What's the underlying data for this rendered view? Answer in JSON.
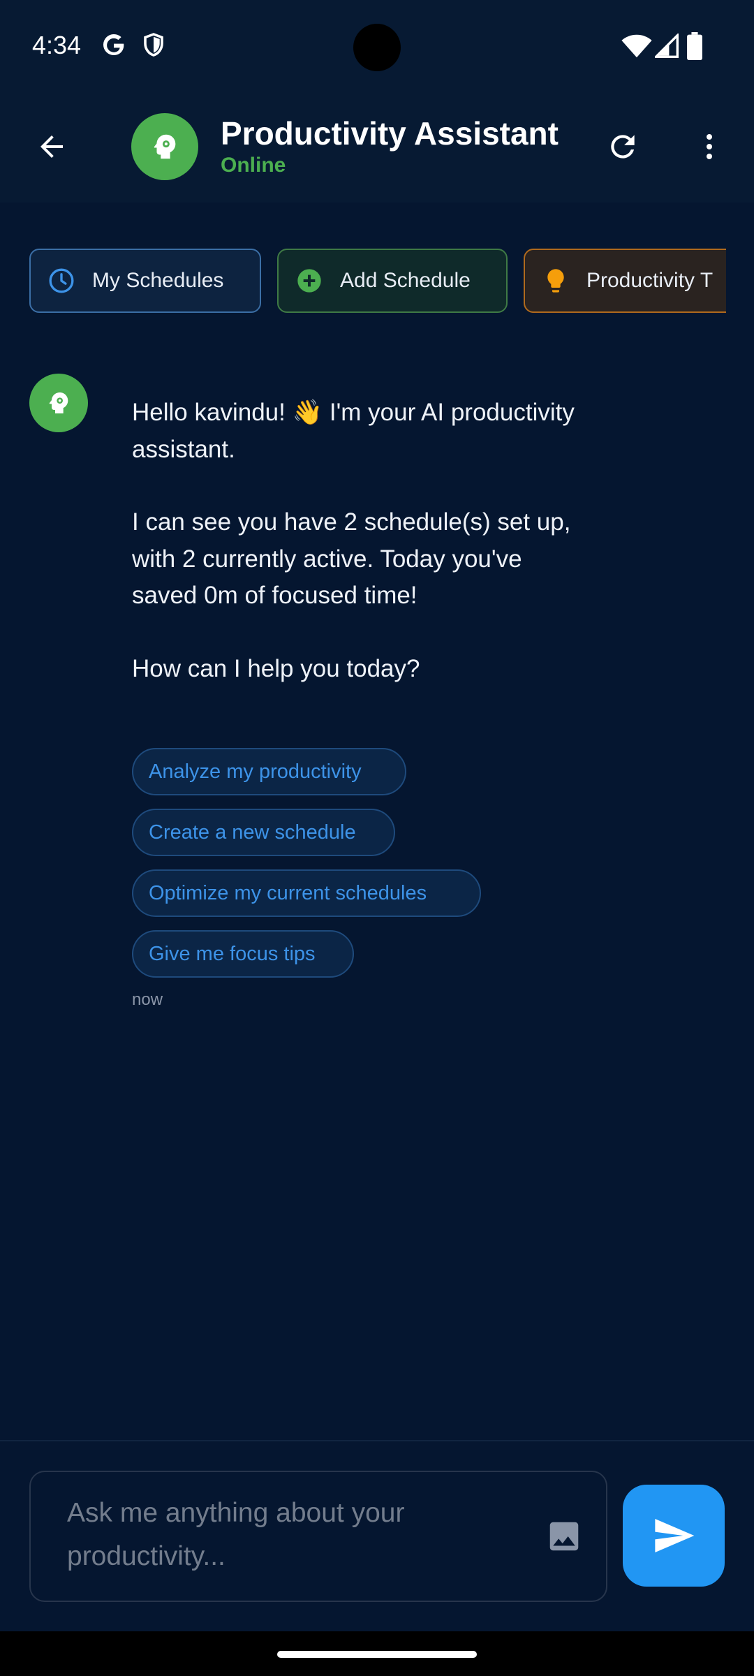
{
  "status_bar": {
    "time": "4:34"
  },
  "header": {
    "title": "Productivity Assistant",
    "status": "Online"
  },
  "quick_actions": [
    {
      "label": "My Schedules",
      "icon": "clock-icon",
      "color": "#3b6ea5"
    },
    {
      "label": "Add Schedule",
      "icon": "add-circle-icon",
      "color": "#4caf50"
    },
    {
      "label": "Productivity T",
      "icon": "lightbulb-icon",
      "color": "#f59e0b"
    }
  ],
  "message": {
    "paragraphs": [
      "Hello kavindu! 👋 I'm your AI productivity assistant.",
      "I can see you have 2 schedule(s) set up, with 2 currently active. Today you've saved 0m of focused time!",
      "How can I help you today?"
    ],
    "suggestions": [
      "Analyze my productivity",
      "Create a new schedule",
      "Optimize my current schedules",
      "Give me focus tips"
    ],
    "timestamp": "now"
  },
  "composer": {
    "placeholder": "Ask me anything about your productivity..."
  },
  "colors": {
    "background": "#051630",
    "accent_green": "#4caf50",
    "accent_blue": "#2196f3",
    "suggestion_text": "#3d93e8"
  }
}
